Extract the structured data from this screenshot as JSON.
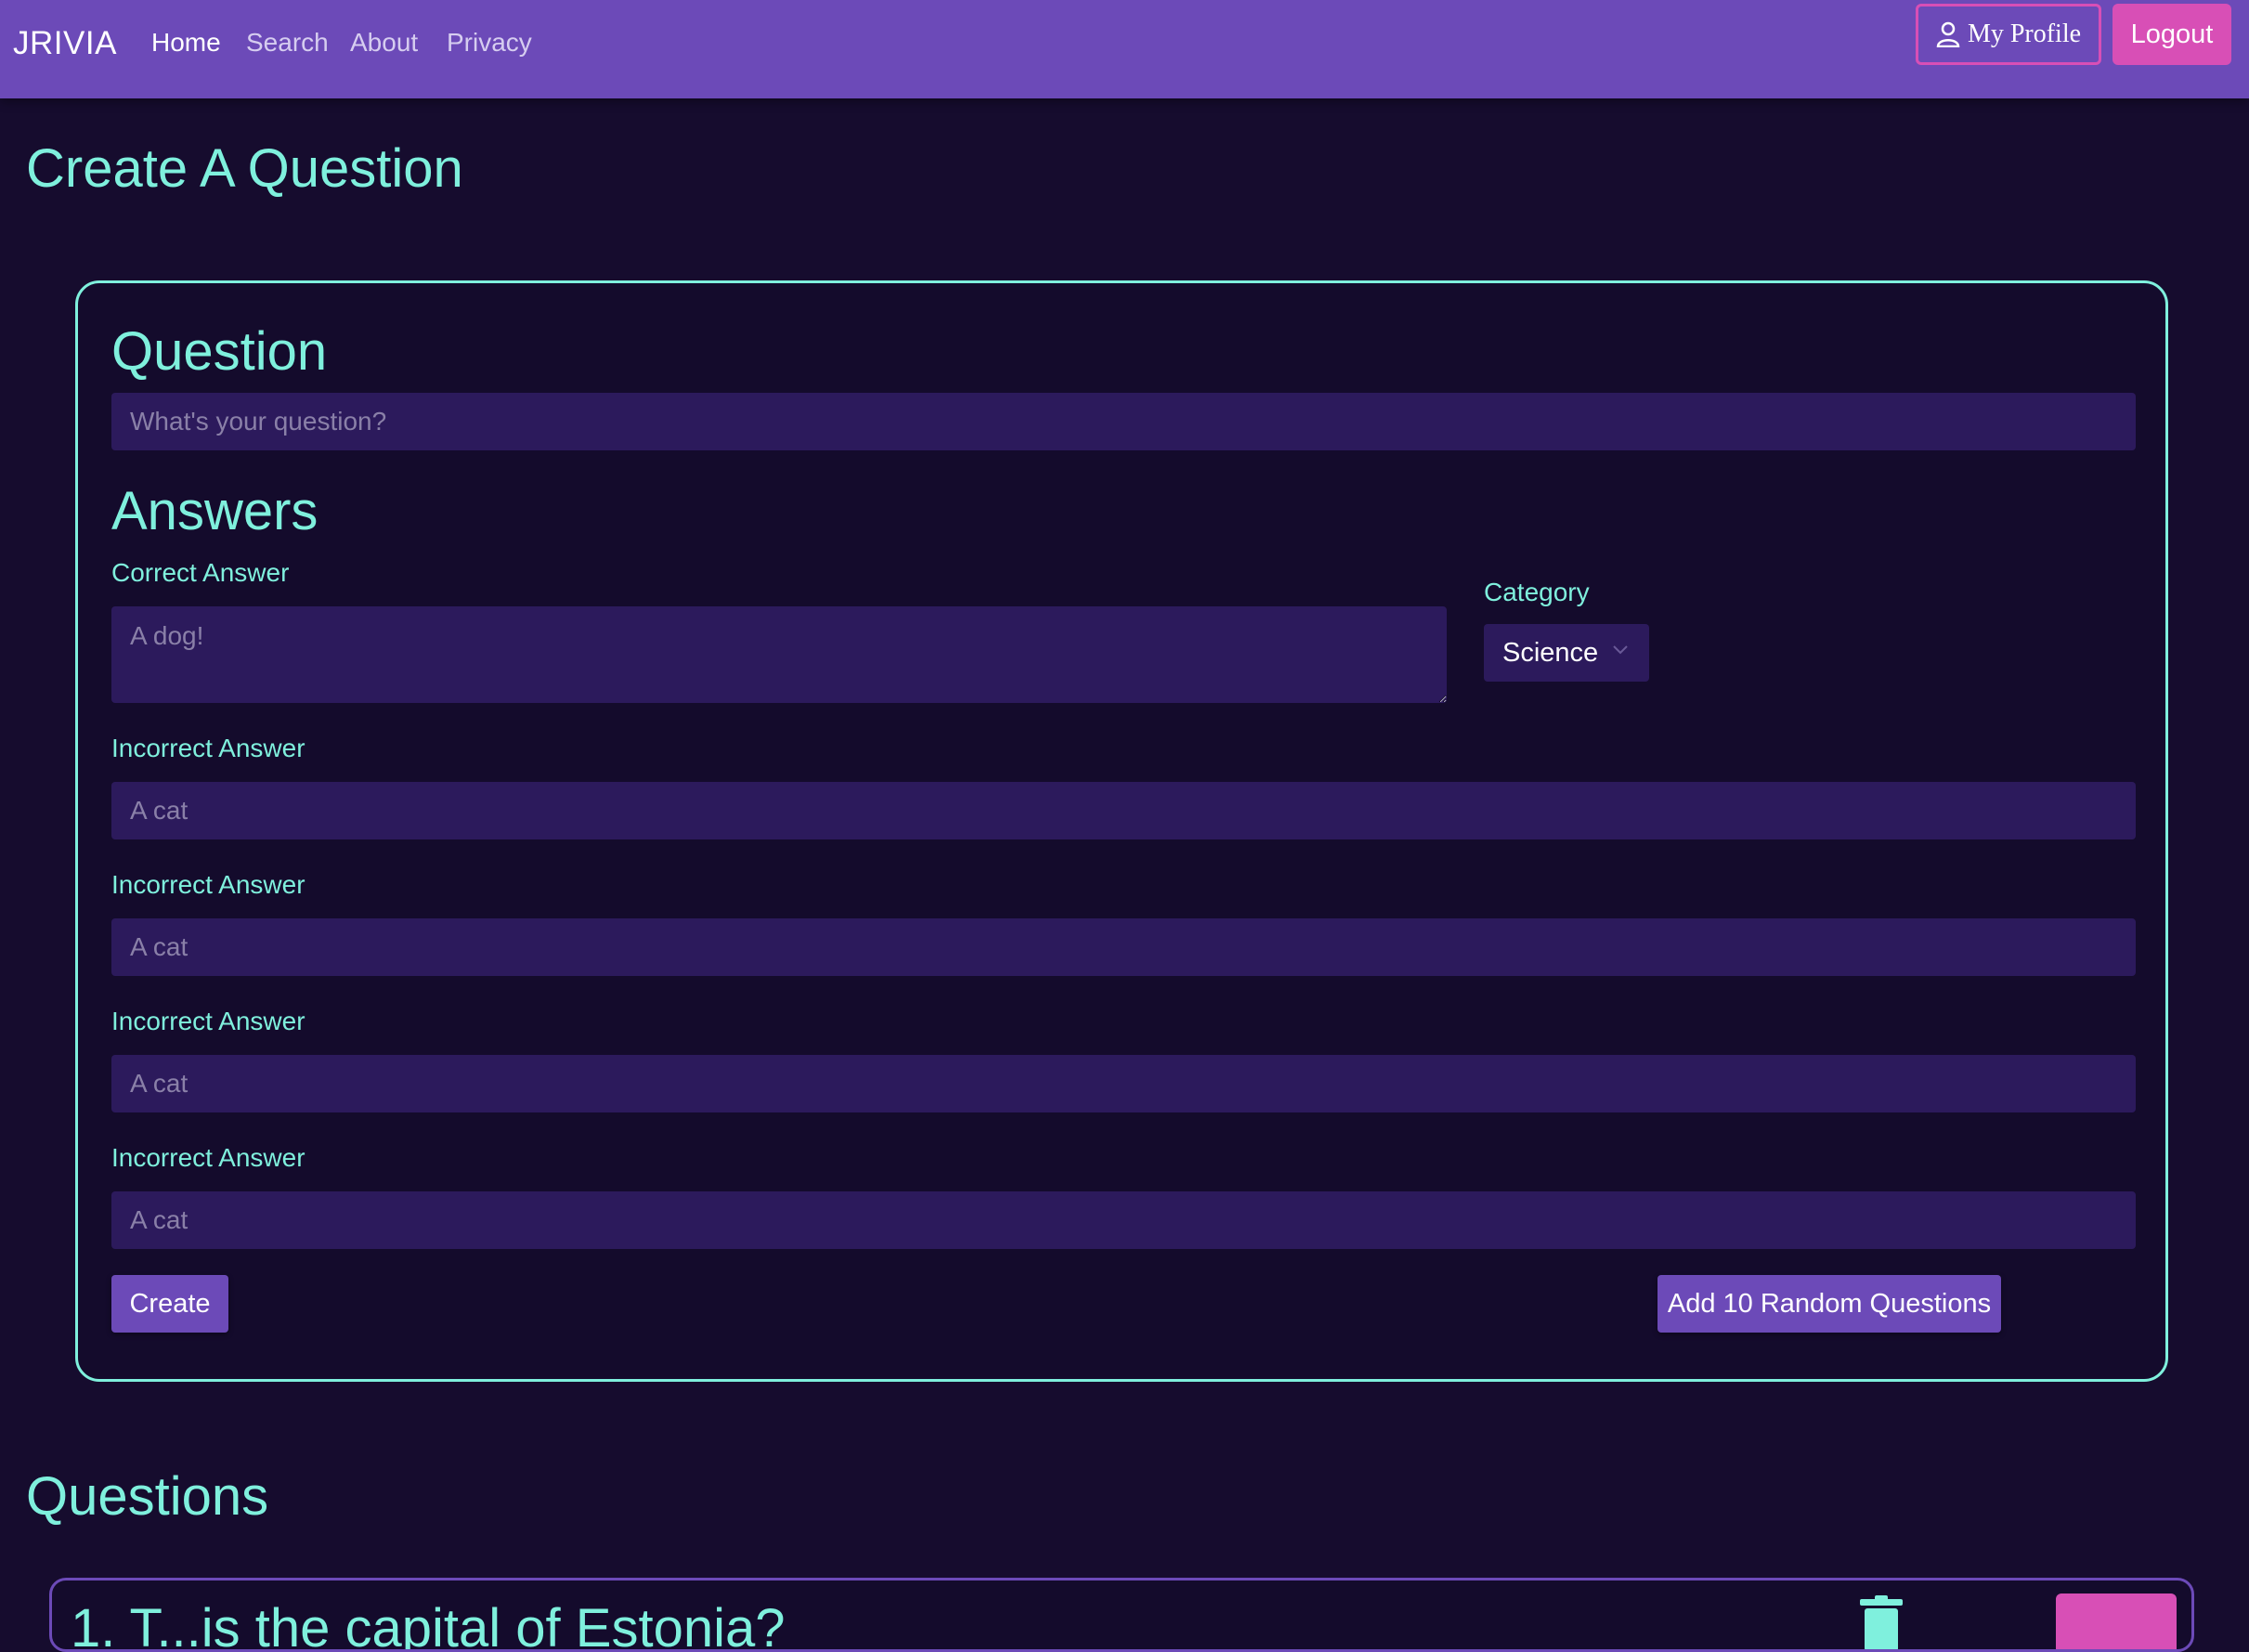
{
  "navbar": {
    "brand": "JRIVIA",
    "links": [
      "Home",
      "Search",
      "About",
      "Privacy"
    ],
    "profile_label": "My Profile",
    "logout_label": "Logout"
  },
  "page": {
    "title": "Create A Question"
  },
  "form": {
    "question_heading": "Question",
    "question_placeholder": "What's your question?",
    "answers_heading": "Answers",
    "correct_label": "Correct Answer",
    "correct_placeholder": "A dog!",
    "category_label": "Category",
    "category_value": "Science",
    "incorrect": [
      {
        "label": "Incorrect Answer",
        "placeholder": "A cat"
      },
      {
        "label": "Incorrect Answer",
        "placeholder": "A cat"
      },
      {
        "label": "Incorrect Answer",
        "placeholder": "A cat"
      },
      {
        "label": "Incorrect Answer",
        "placeholder": "A cat"
      }
    ],
    "create_label": "Create",
    "random_label": "Add 10 Random Questions"
  },
  "questions": {
    "heading": "Questions",
    "items": [
      {
        "text": "1. T...is the capital of Estonia?"
      }
    ]
  },
  "colors": {
    "background": "#160c2e",
    "navbar": "#6c4ab8",
    "accent_text": "#7ff0dd",
    "pink": "#d84fb6",
    "field": "#2c1a5c"
  },
  "icons": {
    "profile": "person-icon",
    "dropdown": "chevron-down-icon",
    "delete": "trash-icon"
  }
}
